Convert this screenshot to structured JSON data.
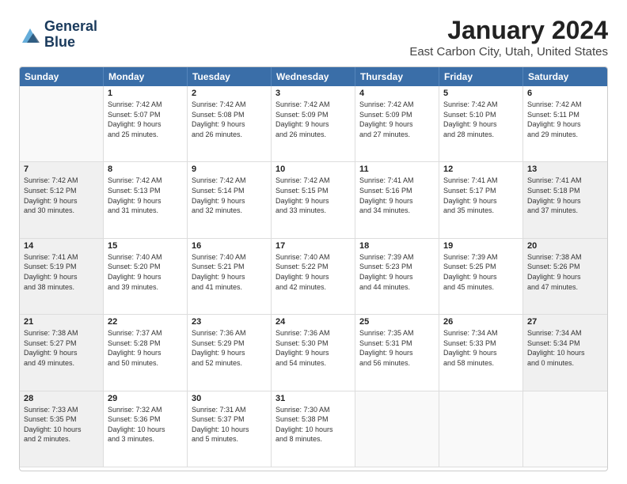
{
  "logo": {
    "line1": "General",
    "line2": "Blue"
  },
  "title": "January 2024",
  "subtitle": "East Carbon City, Utah, United States",
  "header_days": [
    "Sunday",
    "Monday",
    "Tuesday",
    "Wednesday",
    "Thursday",
    "Friday",
    "Saturday"
  ],
  "weeks": [
    [
      {
        "day": "",
        "info": "",
        "empty": true
      },
      {
        "day": "1",
        "info": "Sunrise: 7:42 AM\nSunset: 5:07 PM\nDaylight: 9 hours\nand 25 minutes."
      },
      {
        "day": "2",
        "info": "Sunrise: 7:42 AM\nSunset: 5:08 PM\nDaylight: 9 hours\nand 26 minutes."
      },
      {
        "day": "3",
        "info": "Sunrise: 7:42 AM\nSunset: 5:09 PM\nDaylight: 9 hours\nand 26 minutes."
      },
      {
        "day": "4",
        "info": "Sunrise: 7:42 AM\nSunset: 5:09 PM\nDaylight: 9 hours\nand 27 minutes."
      },
      {
        "day": "5",
        "info": "Sunrise: 7:42 AM\nSunset: 5:10 PM\nDaylight: 9 hours\nand 28 minutes."
      },
      {
        "day": "6",
        "info": "Sunrise: 7:42 AM\nSunset: 5:11 PM\nDaylight: 9 hours\nand 29 minutes."
      }
    ],
    [
      {
        "day": "7",
        "info": "Sunrise: 7:42 AM\nSunset: 5:12 PM\nDaylight: 9 hours\nand 30 minutes.",
        "shaded": true
      },
      {
        "day": "8",
        "info": "Sunrise: 7:42 AM\nSunset: 5:13 PM\nDaylight: 9 hours\nand 31 minutes."
      },
      {
        "day": "9",
        "info": "Sunrise: 7:42 AM\nSunset: 5:14 PM\nDaylight: 9 hours\nand 32 minutes."
      },
      {
        "day": "10",
        "info": "Sunrise: 7:42 AM\nSunset: 5:15 PM\nDaylight: 9 hours\nand 33 minutes."
      },
      {
        "day": "11",
        "info": "Sunrise: 7:41 AM\nSunset: 5:16 PM\nDaylight: 9 hours\nand 34 minutes."
      },
      {
        "day": "12",
        "info": "Sunrise: 7:41 AM\nSunset: 5:17 PM\nDaylight: 9 hours\nand 35 minutes."
      },
      {
        "day": "13",
        "info": "Sunrise: 7:41 AM\nSunset: 5:18 PM\nDaylight: 9 hours\nand 37 minutes.",
        "shaded": true
      }
    ],
    [
      {
        "day": "14",
        "info": "Sunrise: 7:41 AM\nSunset: 5:19 PM\nDaylight: 9 hours\nand 38 minutes.",
        "shaded": true
      },
      {
        "day": "15",
        "info": "Sunrise: 7:40 AM\nSunset: 5:20 PM\nDaylight: 9 hours\nand 39 minutes."
      },
      {
        "day": "16",
        "info": "Sunrise: 7:40 AM\nSunset: 5:21 PM\nDaylight: 9 hours\nand 41 minutes."
      },
      {
        "day": "17",
        "info": "Sunrise: 7:40 AM\nSunset: 5:22 PM\nDaylight: 9 hours\nand 42 minutes."
      },
      {
        "day": "18",
        "info": "Sunrise: 7:39 AM\nSunset: 5:23 PM\nDaylight: 9 hours\nand 44 minutes."
      },
      {
        "day": "19",
        "info": "Sunrise: 7:39 AM\nSunset: 5:25 PM\nDaylight: 9 hours\nand 45 minutes."
      },
      {
        "day": "20",
        "info": "Sunrise: 7:38 AM\nSunset: 5:26 PM\nDaylight: 9 hours\nand 47 minutes.",
        "shaded": true
      }
    ],
    [
      {
        "day": "21",
        "info": "Sunrise: 7:38 AM\nSunset: 5:27 PM\nDaylight: 9 hours\nand 49 minutes.",
        "shaded": true
      },
      {
        "day": "22",
        "info": "Sunrise: 7:37 AM\nSunset: 5:28 PM\nDaylight: 9 hours\nand 50 minutes."
      },
      {
        "day": "23",
        "info": "Sunrise: 7:36 AM\nSunset: 5:29 PM\nDaylight: 9 hours\nand 52 minutes."
      },
      {
        "day": "24",
        "info": "Sunrise: 7:36 AM\nSunset: 5:30 PM\nDaylight: 9 hours\nand 54 minutes."
      },
      {
        "day": "25",
        "info": "Sunrise: 7:35 AM\nSunset: 5:31 PM\nDaylight: 9 hours\nand 56 minutes."
      },
      {
        "day": "26",
        "info": "Sunrise: 7:34 AM\nSunset: 5:33 PM\nDaylight: 9 hours\nand 58 minutes."
      },
      {
        "day": "27",
        "info": "Sunrise: 7:34 AM\nSunset: 5:34 PM\nDaylight: 10 hours\nand 0 minutes.",
        "shaded": true
      }
    ],
    [
      {
        "day": "28",
        "info": "Sunrise: 7:33 AM\nSunset: 5:35 PM\nDaylight: 10 hours\nand 2 minutes.",
        "shaded": true
      },
      {
        "day": "29",
        "info": "Sunrise: 7:32 AM\nSunset: 5:36 PM\nDaylight: 10 hours\nand 3 minutes."
      },
      {
        "day": "30",
        "info": "Sunrise: 7:31 AM\nSunset: 5:37 PM\nDaylight: 10 hours\nand 5 minutes."
      },
      {
        "day": "31",
        "info": "Sunrise: 7:30 AM\nSunset: 5:38 PM\nDaylight: 10 hours\nand 8 minutes."
      },
      {
        "day": "",
        "info": "",
        "empty": true
      },
      {
        "day": "",
        "info": "",
        "empty": true
      },
      {
        "day": "",
        "info": "",
        "empty": true,
        "shaded": true
      }
    ]
  ]
}
